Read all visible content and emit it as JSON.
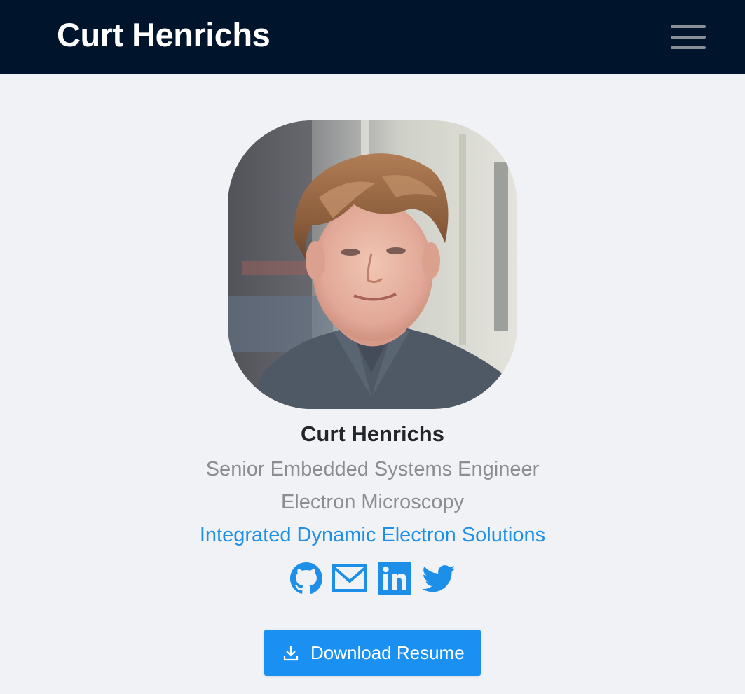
{
  "header": {
    "brand": "Curt Henrichs",
    "menu_icon": "hamburger-menu-icon"
  },
  "profile": {
    "photo_alt": "Profile photo",
    "name": "Curt Henrichs",
    "title": "Senior Embedded Systems Engineer",
    "field": "Electron Microscopy",
    "company": "Integrated Dynamic Electron Solutions"
  },
  "socials": [
    {
      "icon": "github-icon"
    },
    {
      "icon": "email-icon"
    },
    {
      "icon": "linkedin-icon"
    },
    {
      "icon": "twitter-icon"
    }
  ],
  "resume_button": {
    "label": "Download Resume",
    "icon": "download-icon"
  },
  "colors": {
    "navbar": "#00152b",
    "background": "#f0f2f6",
    "accent": "#1e8fe8",
    "button": "#1a91f2"
  }
}
